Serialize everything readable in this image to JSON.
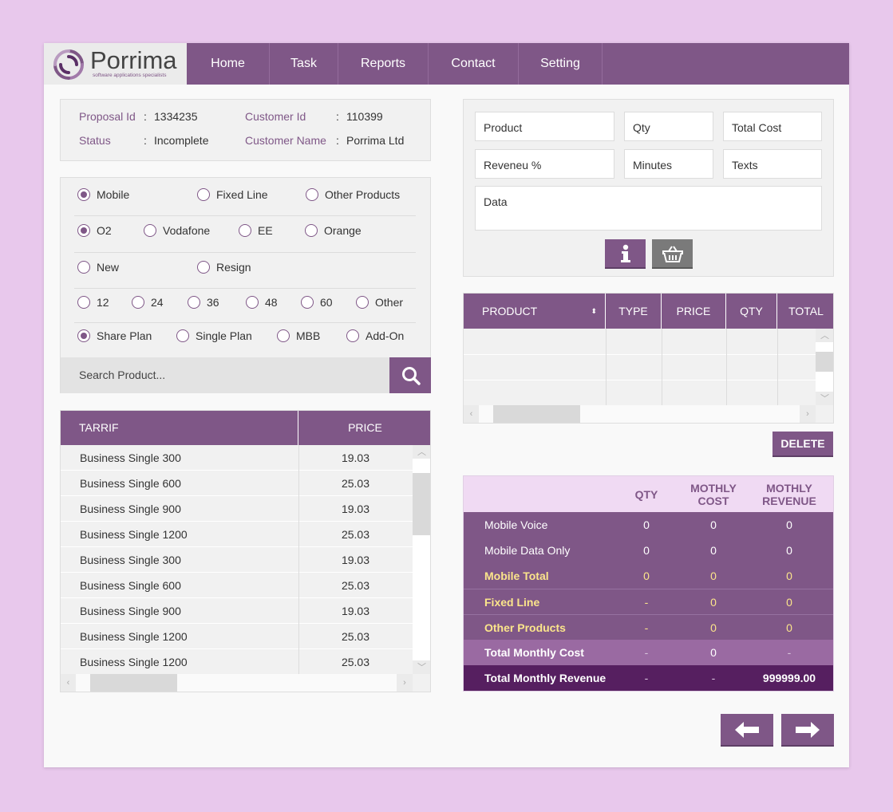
{
  "logo": {
    "name": "Porrima",
    "tagline": "software applications specialists"
  },
  "nav": [
    "Home",
    "Task",
    "Reports",
    "Contact",
    "Setting"
  ],
  "info": {
    "proposal_id_label": "Proposal Id",
    "proposal_id": "1334235",
    "status_label": "Status",
    "status": "Incomplete",
    "customer_id_label": "Customer Id",
    "customer_id": "110399",
    "customer_name_label": "Customer Name",
    "customer_name": "Porrima Ltd",
    "sep": ":"
  },
  "radios": {
    "category": [
      {
        "label": "Mobile",
        "on": true
      },
      {
        "label": "Fixed Line",
        "on": false
      },
      {
        "label": "Other Products",
        "on": false
      }
    ],
    "network": [
      {
        "label": "O2",
        "on": true
      },
      {
        "label": "Vodafone",
        "on": false
      },
      {
        "label": "EE",
        "on": false
      },
      {
        "label": "Orange",
        "on": false
      }
    ],
    "contract": [
      {
        "label": "New",
        "on": false
      },
      {
        "label": "Resign",
        "on": false
      }
    ],
    "term": [
      {
        "label": "12",
        "on": false
      },
      {
        "label": "24",
        "on": false
      },
      {
        "label": "36",
        "on": false
      },
      {
        "label": "48",
        "on": false
      },
      {
        "label": "60",
        "on": false
      },
      {
        "label": "Other",
        "on": false
      }
    ],
    "plan": [
      {
        "label": "Share Plan",
        "on": true
      },
      {
        "label": "Single Plan",
        "on": false
      },
      {
        "label": "MBB",
        "on": false
      },
      {
        "label": "Add-On",
        "on": false
      }
    ]
  },
  "search": {
    "placeholder": "Search Product..."
  },
  "tariff": {
    "headers": [
      "TARRIF",
      "PRICE"
    ],
    "rows": [
      [
        "Business Single 300",
        "19.03"
      ],
      [
        "Business Single 600",
        "25.03"
      ],
      [
        "Business Single 900",
        "19.03"
      ],
      [
        "Business Single 1200",
        "25.03"
      ],
      [
        "Business Single 300",
        "19.03"
      ],
      [
        "Business Single 600",
        "25.03"
      ],
      [
        "Business Single 900",
        "19.03"
      ],
      [
        "Business Single 1200",
        "25.03"
      ],
      [
        "Business Single 1200",
        "25.03"
      ]
    ]
  },
  "form": {
    "product": "Product",
    "qty": "Qty",
    "total_cost": "Total Cost",
    "revenue": "Reveneu %",
    "minutes": "Minutes",
    "texts": "Texts",
    "data": "Data"
  },
  "products_table": {
    "headers": [
      "PRODUCT",
      "TYPE",
      "PRICE",
      "QTY",
      "TOTAL"
    ]
  },
  "delete_label": "DELETE",
  "summary": {
    "headers": [
      "QTY",
      "MOTHLY COST",
      "MOTHLY REVENUE"
    ],
    "rows": [
      {
        "label": "Mobile Voice",
        "qty": "0",
        "cost": "0",
        "rev": "0"
      },
      {
        "label": "Mobile Data Only",
        "qty": "0",
        "cost": "0",
        "rev": "0"
      },
      {
        "label": "Mobile Total",
        "qty": "0",
        "cost": "0",
        "rev": "0"
      },
      {
        "label": "Fixed Line",
        "qty": "-",
        "cost": "0",
        "rev": "0"
      },
      {
        "label": "Other Products",
        "qty": "-",
        "cost": "0",
        "rev": "0"
      },
      {
        "label": "Total Monthly Cost",
        "qty": "-",
        "cost": "0",
        "rev": "-"
      },
      {
        "label": "Total Monthly Revenue",
        "qty": "-",
        "cost": "-",
        "rev": "999999.00"
      }
    ]
  },
  "colors": {
    "accent": "#7f5787",
    "page_bg": "#e8c8ec",
    "highlight": "#fbe58b"
  }
}
